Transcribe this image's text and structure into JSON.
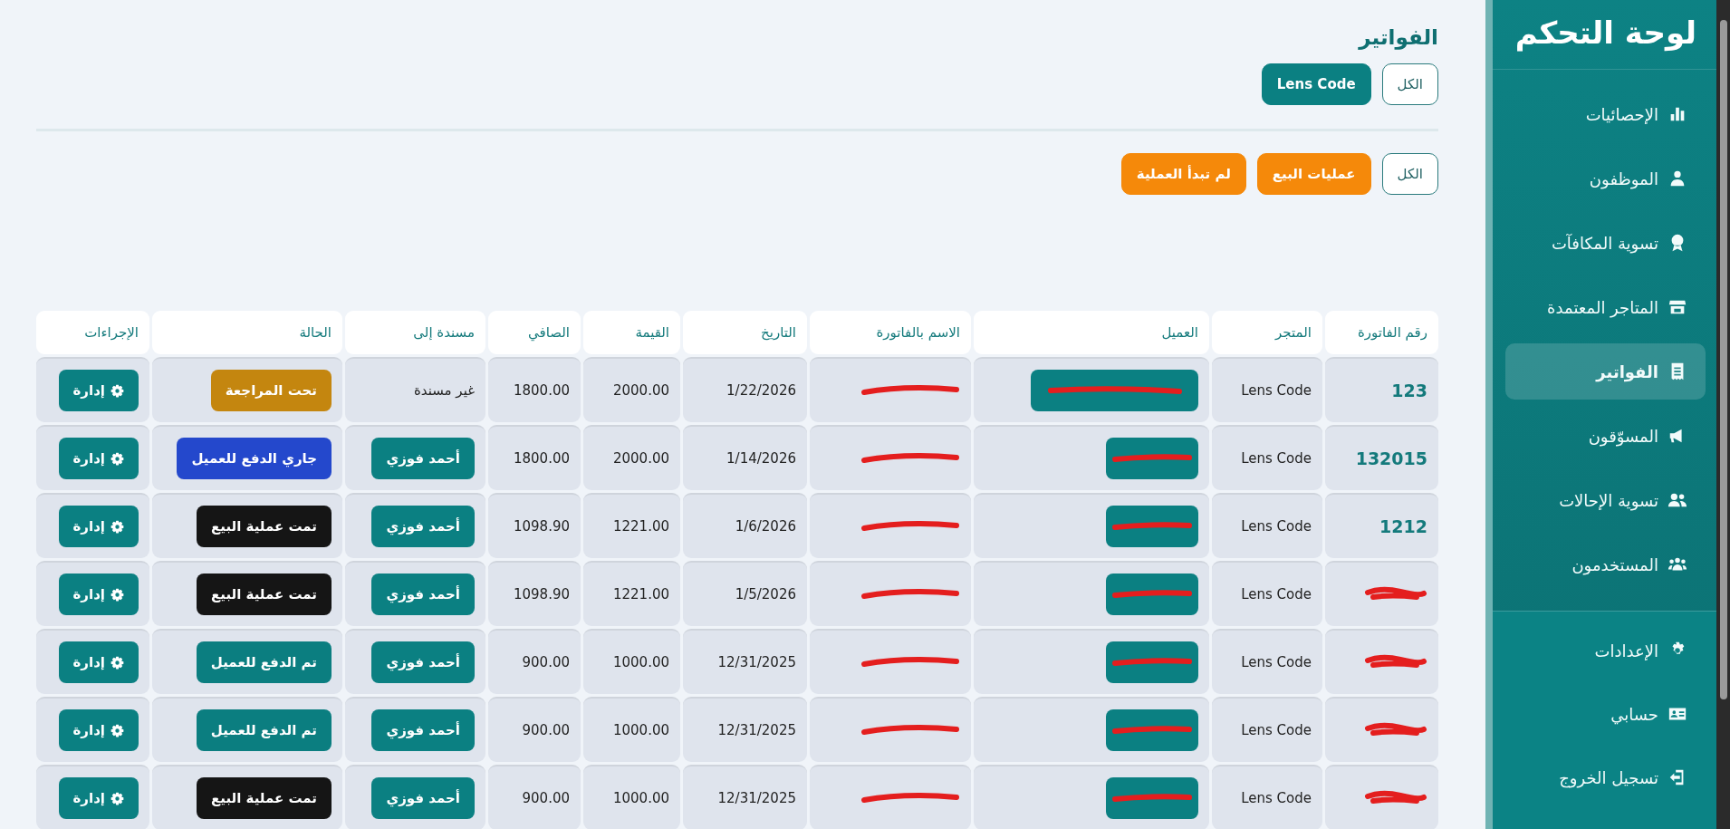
{
  "sidebar": {
    "title": "لوحة التحكم",
    "items": [
      {
        "label": "الإحصائيات",
        "selected": false
      },
      {
        "label": "الموظفون",
        "selected": false
      },
      {
        "label": "تسوية المكافآت",
        "selected": false
      },
      {
        "label": "المتاجر المعتمدة",
        "selected": false
      },
      {
        "label": "الفواتير",
        "selected": true
      },
      {
        "label": "المسوّقون",
        "selected": false
      },
      {
        "label": "تسوية الإحالات",
        "selected": false
      },
      {
        "label": "المستخدمون",
        "selected": false
      }
    ],
    "bottom_items": [
      {
        "label": "الإعدادات"
      },
      {
        "label": "حسابي"
      },
      {
        "label": "تسجيل الخروج"
      }
    ]
  },
  "page_title": "الفواتير",
  "store_filters": [
    {
      "label": "الكل",
      "selected": false
    },
    {
      "label": "Lens Code",
      "selected": true
    }
  ],
  "status_filters": [
    {
      "label": "الكل"
    },
    {
      "label": "عمليات البيع",
      "color": "#f5890a"
    },
    {
      "label": "لم تبدأ العملية",
      "color": "#f5890a"
    }
  ],
  "table": {
    "columns": [
      "رقم الفاتورة",
      "المتجر",
      "العميل",
      "الاسم بالفاتورة",
      "التاريخ",
      "القيمة",
      "الصافي",
      "مسندة إلى",
      "الحالة",
      "الإجراءات"
    ],
    "rows": [
      {
        "invoice_number": "123",
        "store": "Lens Code",
        "date": "1/22/2026",
        "value": "2000.00",
        "net": "1800.00",
        "assigned": {
          "kind": "text",
          "label": "غير مسندة"
        },
        "status": {
          "kind": "review",
          "label": "تحت المراجعة"
        },
        "action": "إدارة"
      },
      {
        "invoice_number": "132015",
        "store": "Lens Code",
        "date": "1/14/2026",
        "value": "2000.00",
        "net": "1800.00",
        "assigned": {
          "kind": "button",
          "label": "أحمد فوزي"
        },
        "status": {
          "kind": "paying",
          "label": "جاري الدفع للعميل"
        },
        "action": "إدارة"
      },
      {
        "invoice_number": "1212",
        "store": "Lens Code",
        "date": "1/6/2026",
        "value": "1221.00",
        "net": "1098.90",
        "assigned": {
          "kind": "button",
          "label": "أحمد فوزي"
        },
        "status": {
          "kind": "sold",
          "label": "تمت عملية البيع"
        },
        "action": "إدارة"
      },
      {
        "store": "Lens Code",
        "date": "1/5/2026",
        "value": "1221.00",
        "net": "1098.90",
        "assigned": {
          "kind": "button",
          "label": "أحمد فوزي"
        },
        "status": {
          "kind": "sold",
          "label": "تمت عملية البيع"
        },
        "action": "إدارة"
      },
      {
        "store": "Lens Code",
        "date": "12/31/2025",
        "value": "1000.00",
        "net": "900.00",
        "assigned": {
          "kind": "button",
          "label": "أحمد فوزي"
        },
        "status": {
          "kind": "paid",
          "label": "تم الدفع للعميل"
        },
        "action": "إدارة"
      },
      {
        "store": "Lens Code",
        "date": "12/31/2025",
        "value": "1000.00",
        "net": "900.00",
        "assigned": {
          "kind": "button",
          "label": "أحمد فوزي"
        },
        "status": {
          "kind": "paid",
          "label": "تم الدفع للعميل"
        },
        "action": "إدارة"
      },
      {
        "store": "Lens Code",
        "date": "12/31/2025",
        "value": "1000.00",
        "net": "900.00",
        "assigned": {
          "kind": "button",
          "label": "أحمد فوزي"
        },
        "status": {
          "kind": "sold",
          "label": "تمت عملية البيع"
        },
        "action": "إدارة"
      }
    ]
  }
}
